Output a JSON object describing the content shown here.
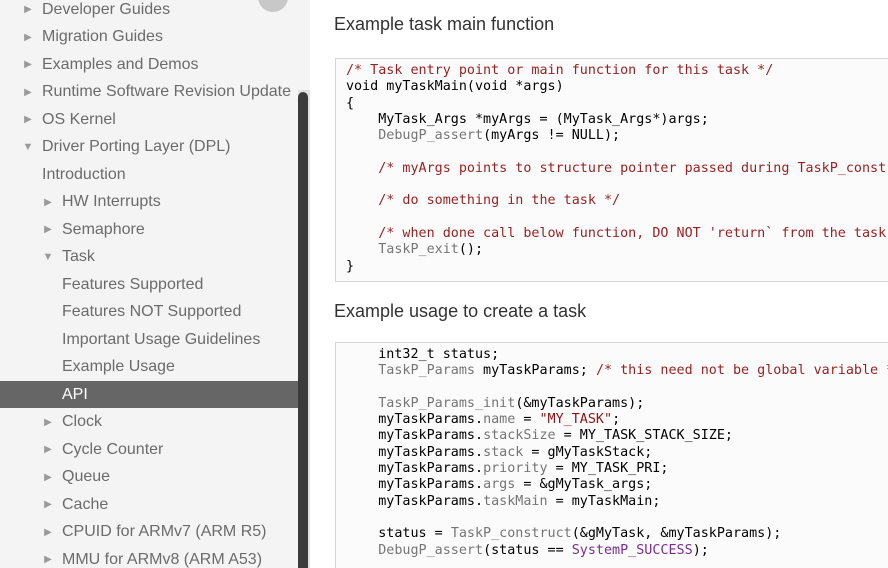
{
  "sidebar": {
    "items": [
      {
        "label": "Developer Guides",
        "level": 0,
        "arrow": "right"
      },
      {
        "label": "Migration Guides",
        "level": 0,
        "arrow": "right"
      },
      {
        "label": "Examples and Demos",
        "level": 0,
        "arrow": "right"
      },
      {
        "label": "Runtime Software Revision Update",
        "level": 0,
        "arrow": "right"
      },
      {
        "label": "OS Kernel",
        "level": 0,
        "arrow": "right"
      },
      {
        "label": "Driver Porting Layer (DPL)",
        "level": 0,
        "arrow": "down"
      },
      {
        "label": "Introduction",
        "level": 1,
        "arrow": "none"
      },
      {
        "label": "HW Interrupts",
        "level": 1,
        "arrow": "right"
      },
      {
        "label": "Semaphore",
        "level": 1,
        "arrow": "right"
      },
      {
        "label": "Task",
        "level": 1,
        "arrow": "down"
      },
      {
        "label": "Features Supported",
        "level": 2,
        "arrow": "none"
      },
      {
        "label": "Features NOT Supported",
        "level": 2,
        "arrow": "none"
      },
      {
        "label": "Important Usage Guidelines",
        "level": 2,
        "arrow": "none"
      },
      {
        "label": "Example Usage",
        "level": 2,
        "arrow": "none"
      },
      {
        "label": "API",
        "level": 2,
        "arrow": "none",
        "active": true
      },
      {
        "label": "Clock",
        "level": 1,
        "arrow": "right"
      },
      {
        "label": "Cycle Counter",
        "level": 1,
        "arrow": "right"
      },
      {
        "label": "Queue",
        "level": 1,
        "arrow": "right"
      },
      {
        "label": "Cache",
        "level": 1,
        "arrow": "right"
      },
      {
        "label": "CPUID for ARMv7 (ARM R5)",
        "level": 1,
        "arrow": "right"
      },
      {
        "label": "MMU for ARMv8 (ARM A53)",
        "level": 1,
        "arrow": "right"
      }
    ]
  },
  "main": {
    "section1": {
      "heading": "Example task main function",
      "lines": [
        [
          [
            "c",
            "/* Task entry point or main function for this task */"
          ]
        ],
        [
          [
            "",
            "void myTaskMain(void *args)"
          ]
        ],
        [
          [
            "",
            "{"
          ]
        ],
        [
          [
            "",
            "    MyTask_Args *myArgs = (MyTask_Args*)args;"
          ]
        ],
        [
          [
            "t",
            "    DebugP_assert"
          ],
          [
            "",
            "(myArgs != NULL);"
          ]
        ],
        [
          [
            "",
            ""
          ]
        ],
        [
          [
            "c",
            "    /* myArgs points to structure pointer passed during TaskP_construct */"
          ]
        ],
        [
          [
            "",
            ""
          ]
        ],
        [
          [
            "c",
            "    /* do something in the task */"
          ]
        ],
        [
          [
            "",
            ""
          ]
        ],
        [
          [
            "c",
            "    /* when done call below function, DO NOT 'return` from the task */"
          ]
        ],
        [
          [
            "t",
            "    TaskP_exit"
          ],
          [
            "",
            "();"
          ]
        ],
        [
          [
            "",
            "}"
          ]
        ]
      ]
    },
    "section2": {
      "heading": "Example usage to create a task",
      "lines": [
        [
          [
            "",
            "    int32_t status;"
          ]
        ],
        [
          [
            "t",
            "    TaskP_Params"
          ],
          [
            "",
            " myTaskParams; "
          ],
          [
            "c",
            "/* this need not be global variable */"
          ]
        ],
        [
          [
            "",
            ""
          ]
        ],
        [
          [
            "t",
            "    TaskP_Params_init"
          ],
          [
            "",
            "(&myTaskParams);"
          ]
        ],
        [
          [
            "",
            "    myTaskParams."
          ],
          [
            "t",
            "name"
          ],
          [
            "",
            " = "
          ],
          [
            "s",
            "\"MY_TASK\""
          ],
          [
            "",
            ";"
          ]
        ],
        [
          [
            "",
            "    myTaskParams."
          ],
          [
            "t",
            "stackSize"
          ],
          [
            "",
            " = MY_TASK_STACK_SIZE;"
          ]
        ],
        [
          [
            "",
            "    myTaskParams."
          ],
          [
            "t",
            "stack"
          ],
          [
            "",
            " = gMyTaskStack;"
          ]
        ],
        [
          [
            "",
            "    myTaskParams."
          ],
          [
            "t",
            "priority"
          ],
          [
            "",
            " = MY_TASK_PRI;"
          ]
        ],
        [
          [
            "",
            "    myTaskParams."
          ],
          [
            "t",
            "args"
          ],
          [
            "",
            " = &gMyTask_args;"
          ]
        ],
        [
          [
            "",
            "    myTaskParams."
          ],
          [
            "t",
            "taskMain"
          ],
          [
            "",
            " = myTaskMain;"
          ]
        ],
        [
          [
            "",
            ""
          ]
        ],
        [
          [
            "",
            "    status = "
          ],
          [
            "t",
            "TaskP_construct"
          ],
          [
            "",
            "(&gMyTask, &myTaskParams);"
          ]
        ],
        [
          [
            "t",
            "    DebugP_assert"
          ],
          [
            "",
            "(status == "
          ],
          [
            "p",
            "SystemP_SUCCESS"
          ],
          [
            "",
            ");"
          ]
        ]
      ]
    }
  }
}
